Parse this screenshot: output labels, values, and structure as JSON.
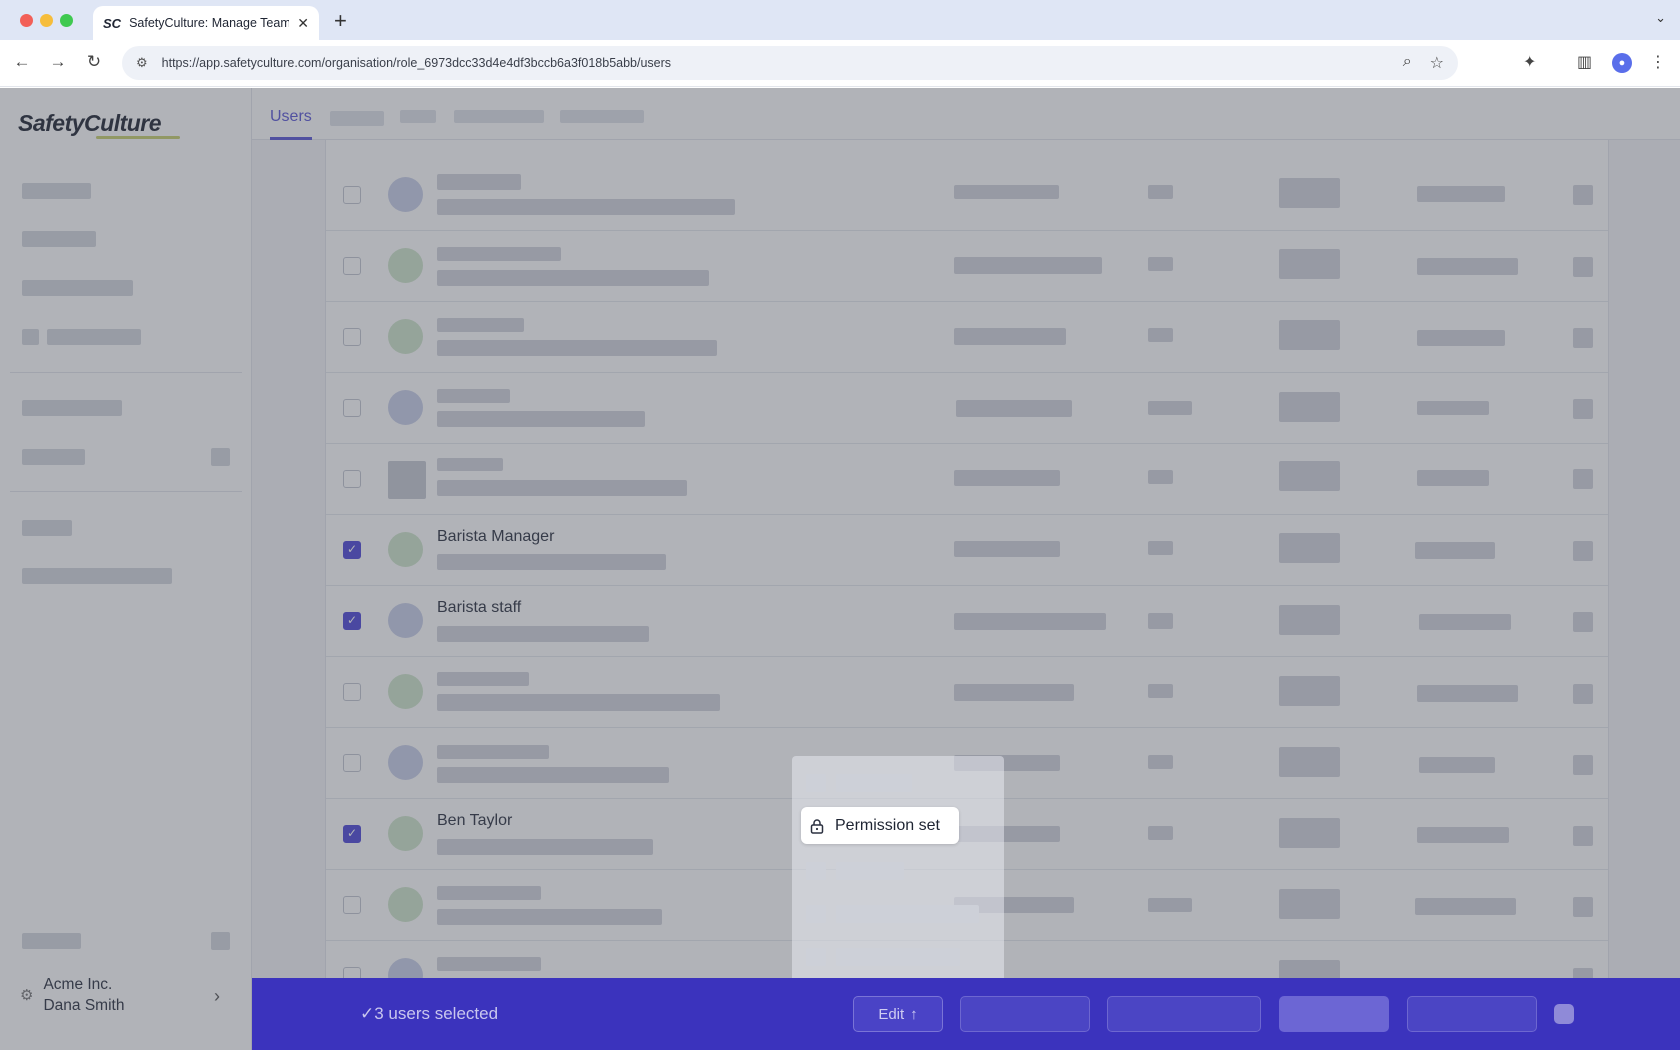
{
  "browser": {
    "tab_title": "SafetyCulture: Manage Teams and...",
    "favicon": "SC",
    "url": "https://app.safetyculture.com/organisation/role_6973dcc33d4e4df3bccb6a3f018b5abb/users"
  },
  "app": {
    "logo": "SafetyCulture",
    "nav_tab_active": "Users",
    "org_name": "Acme Inc.",
    "user_name": "Dana Smith"
  },
  "rows": [
    {
      "name": "",
      "checked": false
    },
    {
      "name": "",
      "checked": false
    },
    {
      "name": "",
      "checked": false
    },
    {
      "name": "",
      "checked": false
    },
    {
      "name": "",
      "checked": false
    },
    {
      "name": "Barista Manager",
      "checked": true
    },
    {
      "name": "Barista staff",
      "checked": true
    },
    {
      "name": "",
      "checked": false
    },
    {
      "name": "",
      "checked": false
    },
    {
      "name": "Ben Taylor",
      "checked": true
    },
    {
      "name": "",
      "checked": false
    },
    {
      "name": "",
      "checked": false
    }
  ],
  "menu": {
    "highlighted_item": "Permission set"
  },
  "bottom_bar": {
    "selected_text": "3 users selected",
    "edit_label": "Edit"
  },
  "colors": {
    "brand": "#3b33bd",
    "accent": "#5a56d6"
  }
}
